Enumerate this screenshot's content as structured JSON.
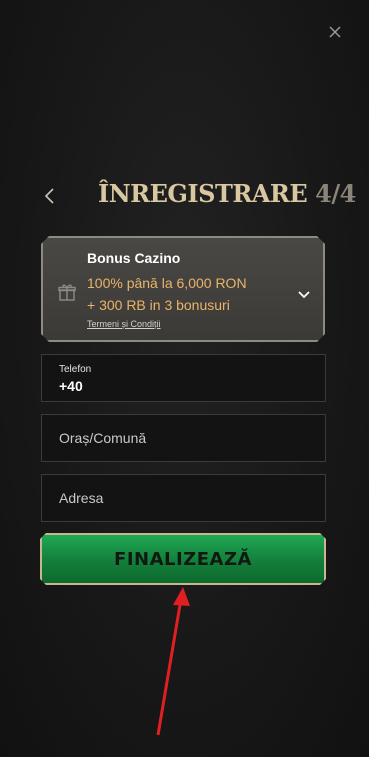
{
  "header": {
    "title": "ÎNREGISTRARE",
    "step": "4/4"
  },
  "bonus": {
    "title": "Bonus Cazino",
    "line1": "100% până la 6,000 RON",
    "line2": "+ 300 RB in 3 bonusuri",
    "terms": "Termeni și Condiții"
  },
  "form": {
    "phone_label": "Telefon",
    "phone_value": "+40",
    "city_placeholder": "Oraș/Comună",
    "address_placeholder": "Adresa"
  },
  "submit": {
    "label": "FINALIZEAZĂ"
  },
  "colors": {
    "accent_gold": "#d8c7a1",
    "bonus_orange": "#e9b46a",
    "button_green": "#137e3a",
    "annotation_red": "#e02020"
  },
  "icons": {
    "close": "close-icon",
    "back": "chevron-left-icon",
    "gift": "gift-icon",
    "expand": "chevron-down-icon"
  }
}
